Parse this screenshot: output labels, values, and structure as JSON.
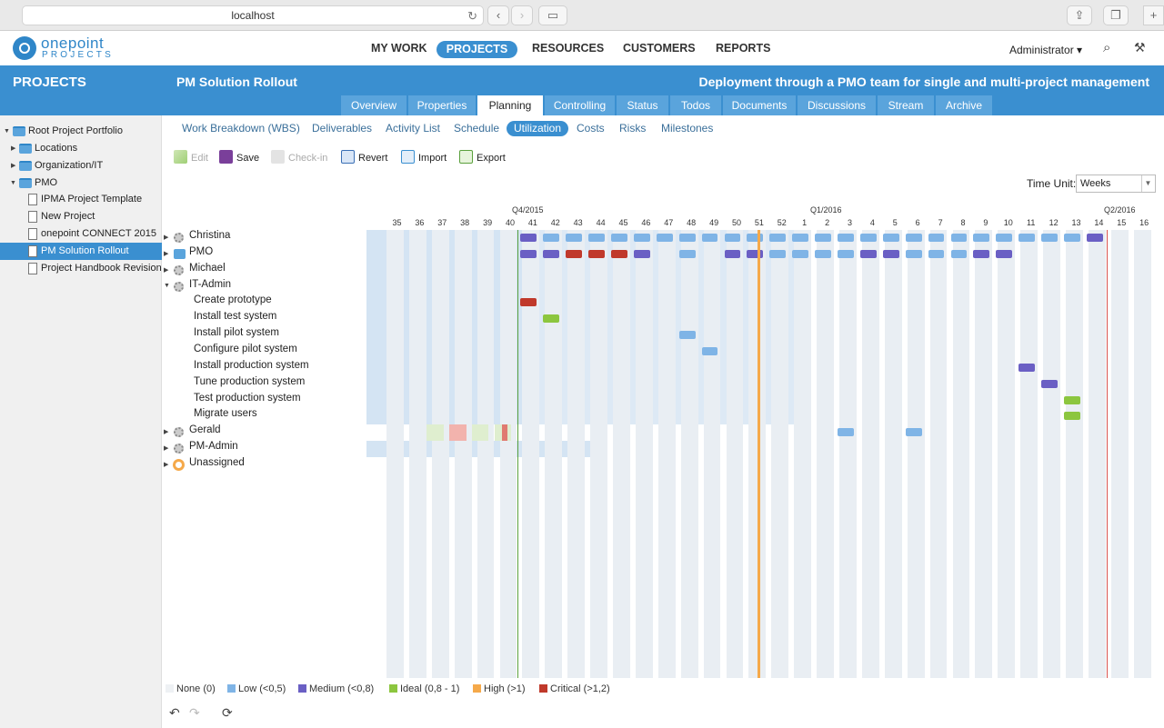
{
  "browser": {
    "url": "localhost"
  },
  "logo": {
    "name": "onepoint",
    "sub": "PROJECTS"
  },
  "nav": {
    "items": [
      "MY WORK",
      "PROJECTS",
      "RESOURCES",
      "CUSTOMERS",
      "REPORTS"
    ],
    "active": "PROJECTS",
    "user": "Administrator ▾"
  },
  "project": {
    "section": "PROJECTS",
    "title": "PM Solution Rollout",
    "description": "Deployment through a PMO team for single and multi-project management"
  },
  "tabs": [
    "Overview",
    "Properties",
    "Planning",
    "Controlling",
    "Status",
    "Todos",
    "Documents",
    "Discussions",
    "Stream",
    "Archive"
  ],
  "active_tab": "Planning",
  "subtabs": [
    "Work Breakdown (WBS)",
    "Deliverables",
    "Activity List",
    "Schedule",
    "Utilization",
    "Costs",
    "Risks",
    "Milestones"
  ],
  "active_subtab": "Utilization",
  "toolbar": {
    "edit": "Edit",
    "save": "Save",
    "checkin": "Check-in",
    "revert": "Revert",
    "import": "Import",
    "export": "Export"
  },
  "tree": [
    {
      "label": "Root Project Portfolio",
      "level": 0,
      "type": "folder",
      "expanded": true
    },
    {
      "label": "Locations",
      "level": 1,
      "type": "folder"
    },
    {
      "label": "Organization/IT",
      "level": 1,
      "type": "folder"
    },
    {
      "label": "PMO",
      "level": 1,
      "type": "folder",
      "expanded": true
    },
    {
      "label": "IPMA Project Template",
      "level": 2,
      "type": "template"
    },
    {
      "label": "New Project",
      "level": 2,
      "type": "project"
    },
    {
      "label": "onepoint CONNECT 2015",
      "level": 2,
      "type": "project"
    },
    {
      "label": "PM Solution Rollout",
      "level": 2,
      "type": "project",
      "active": true
    },
    {
      "label": "Project Handbook Revision",
      "level": 2,
      "type": "project"
    }
  ],
  "time_unit": {
    "label": "Time Unit:",
    "value": "Weeks"
  },
  "timeline": {
    "quarters": [
      {
        "label": "Q4/2015"
      },
      {
        "label": "Q1/2016"
      },
      {
        "label": "Q2/2016"
      }
    ],
    "weeks": [
      "35",
      "36",
      "37",
      "38",
      "39",
      "40",
      "41",
      "42",
      "43",
      "44",
      "45",
      "46",
      "47",
      "48",
      "49",
      "50",
      "51",
      "52",
      "1",
      "2",
      "3",
      "4",
      "5",
      "6",
      "7",
      "8",
      "9",
      "10",
      "11",
      "12",
      "13",
      "14",
      "15",
      "16"
    ]
  },
  "resources": [
    {
      "label": "Christina",
      "kind": "resource",
      "row": 0
    },
    {
      "label": "PMO",
      "kind": "pool",
      "row": 1
    },
    {
      "label": "Michael",
      "kind": "resource",
      "row": 2
    },
    {
      "label": "IT-Admin",
      "kind": "resource",
      "row": 3,
      "expanded": true
    },
    {
      "label": "Create prototype",
      "kind": "task",
      "row": 4
    },
    {
      "label": "Install test system",
      "kind": "task",
      "row": 5
    },
    {
      "label": "Install pilot system",
      "kind": "task",
      "row": 6
    },
    {
      "label": "Configure pilot system",
      "kind": "task",
      "row": 7
    },
    {
      "label": "Install production system",
      "kind": "task",
      "row": 8
    },
    {
      "label": "Tune production system",
      "kind": "task",
      "row": 9
    },
    {
      "label": "Test production system",
      "kind": "task",
      "row": 10
    },
    {
      "label": "Migrate users",
      "kind": "task",
      "row": 11
    },
    {
      "label": "Gerald",
      "kind": "resource",
      "row": 12
    },
    {
      "label": "PM-Admin",
      "kind": "resource",
      "row": 13
    },
    {
      "label": "Unassigned",
      "kind": "unassigned",
      "row": 14
    }
  ],
  "utilization": [
    {
      "row": 0,
      "level": "medium",
      "weeks": [
        6
      ]
    },
    {
      "row": 0,
      "level": "low",
      "weeks": [
        7,
        8,
        9,
        10,
        11,
        12,
        13,
        14,
        15,
        16,
        17,
        18,
        19,
        20,
        21,
        22,
        23,
        24,
        25,
        26,
        27,
        28,
        29,
        30
      ]
    },
    {
      "row": 0,
      "level": "medium",
      "weeks": [
        31
      ]
    },
    {
      "row": 1,
      "level": "medium",
      "weeks": [
        6,
        7
      ]
    },
    {
      "row": 1,
      "level": "critical",
      "weeks": [
        8,
        9,
        10
      ]
    },
    {
      "row": 1,
      "level": "medium",
      "weeks": [
        11
      ]
    },
    {
      "row": 1,
      "level": "low",
      "weeks": [
        13
      ]
    },
    {
      "row": 1,
      "level": "medium",
      "weeks": [
        15,
        16
      ]
    },
    {
      "row": 1,
      "level": "low",
      "weeks": [
        17,
        18,
        19,
        20
      ]
    },
    {
      "row": 1,
      "level": "medium",
      "weeks": [
        21,
        22
      ]
    },
    {
      "row": 1,
      "level": "low",
      "weeks": [
        23,
        24,
        25
      ]
    },
    {
      "row": 1,
      "level": "medium",
      "weeks": [
        26,
        27
      ]
    },
    {
      "row": 4,
      "level": "critical",
      "weeks": [
        6
      ]
    },
    {
      "row": 5,
      "level": "ideal",
      "weeks": [
        7
      ]
    },
    {
      "row": 6,
      "level": "low",
      "weeks": [
        13
      ]
    },
    {
      "row": 7,
      "level": "low",
      "weeks": [
        14
      ]
    },
    {
      "row": 8,
      "level": "medium",
      "weeks": [
        28
      ]
    },
    {
      "row": 9,
      "level": "medium",
      "weeks": [
        29
      ]
    },
    {
      "row": 10,
      "level": "ideal",
      "weeks": [
        30
      ]
    },
    {
      "row": 11,
      "level": "ideal",
      "weeks": [
        30
      ]
    },
    {
      "row": 12,
      "level": "low",
      "weeks": [
        20,
        23
      ]
    }
  ],
  "legend": [
    {
      "label": "None (0)",
      "color": "#eef1f4"
    },
    {
      "label": "Low (<0,5)",
      "color": "#7fb4e6"
    },
    {
      "label": "Medium (<0,8)",
      "color": "#6a5fc4"
    },
    {
      "label": "Ideal (0,8 - 1)",
      "color": "#8cc63f"
    },
    {
      "label": "High (>1)",
      "color": "#f5a94a"
    },
    {
      "label": "Critical (>1,2)",
      "color": "#c0392b"
    }
  ],
  "colors": {
    "brand": "#3a8fd0",
    "low": "#7fb4e6",
    "medium": "#6a5fc4",
    "ideal": "#8cc63f",
    "high": "#f5a94a",
    "critical": "#c0392b",
    "today_line": "#5aa03c",
    "deadline_line": "#d9534f"
  }
}
